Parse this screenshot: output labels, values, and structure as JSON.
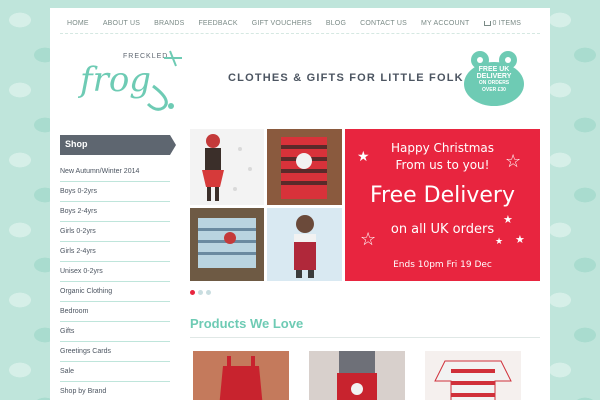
{
  "nav": {
    "items": [
      "HOME",
      "ABOUT US",
      "BRANDS",
      "FEEDBACK",
      "GIFT VOUCHERS",
      "BLOG",
      "CONTACT US",
      "MY ACCOUNT"
    ],
    "cart": "0 ITEMS"
  },
  "logo": {
    "small": "FRECKLED",
    "big": "frog"
  },
  "tagline": "CLOTHES & GIFTS FOR LITTLE FOLK",
  "badge": {
    "line1": "FREE UK",
    "line2": "DELIVERY",
    "line3": "ON ORDERS",
    "line4": "OVER £30"
  },
  "sidebar": {
    "heading": "Shop",
    "items": [
      "New Autumn/Winter 2014",
      "Boys 0-2yrs",
      "Boys 2-4yrs",
      "Girls 0-2yrs",
      "Girls 2-4yrs",
      "Unisex 0-2yrs",
      "Organic Clothing",
      "Bedroom",
      "Gifts",
      "Greetings Cards",
      "Sale",
      "Shop by Brand"
    ]
  },
  "promo": {
    "line1": "Happy Christmas",
    "line2": "From us to you!",
    "line3": "Free Delivery",
    "line4": "on all UK orders",
    "line5": "Ends 10pm Fri 19 Dec"
  },
  "slider": {
    "active_dot": 1,
    "dot_count": 3
  },
  "products": {
    "title": "Products We Love"
  },
  "colors": {
    "mint": "#6ecbb4",
    "promo_red": "#e8253f",
    "background": "#bfe5db",
    "dark": "#5e6670"
  },
  "icons": [
    "cart-icon",
    "frog-logo",
    "frog-badge",
    "star-icon"
  ]
}
